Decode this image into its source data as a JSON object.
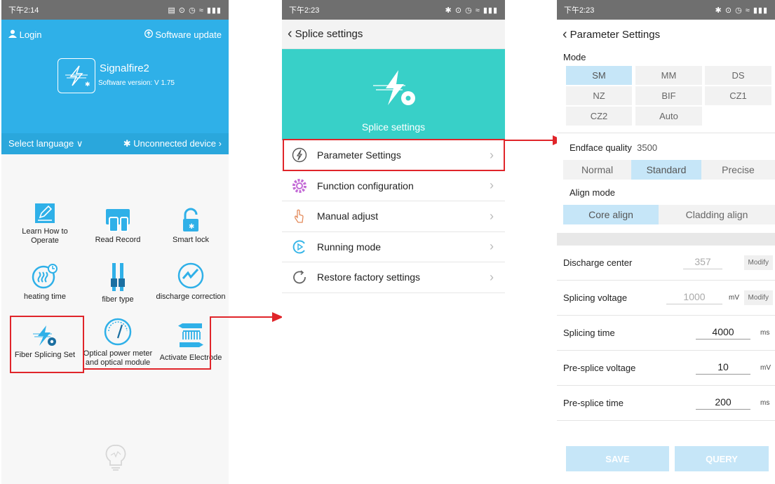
{
  "phone1": {
    "status_time": "下午2:14",
    "login": "Login",
    "software_update": "Software update",
    "app_name": "Signalfire2",
    "software_version": "Software version: V 1.75",
    "select_language": "Select language",
    "unconnected_device": "Unconnected device",
    "grid": [
      {
        "label": "Learn How to Operate",
        "icon": "learn-icon"
      },
      {
        "label": "Read Record",
        "icon": "read-record-icon"
      },
      {
        "label": "Smart lock",
        "icon": "smart-lock-icon"
      },
      {
        "label": "heating time",
        "icon": "heating-icon"
      },
      {
        "label": "fiber type",
        "icon": "fiber-type-icon"
      },
      {
        "label": "discharge correction",
        "icon": "discharge-icon"
      },
      {
        "label": "Fiber Splicing Set",
        "icon": "fiber-splicing-icon"
      },
      {
        "label": "Optical power meter and optical module",
        "icon": "power-meter-icon"
      },
      {
        "label": "Activate Electrode",
        "icon": "electrode-icon"
      }
    ]
  },
  "phone2": {
    "status_time": "下午2:23",
    "nav_title": "Splice settings",
    "banner_label": "Splice settings",
    "menu": [
      {
        "label": "Parameter Settings",
        "icon": "lightning-icon"
      },
      {
        "label": "Function configuration",
        "icon": "gear-icon"
      },
      {
        "label": "Manual adjust",
        "icon": "hand-icon"
      },
      {
        "label": "Running mode",
        "icon": "running-mode-icon"
      },
      {
        "label": "Restore factory settings",
        "icon": "restore-icon"
      }
    ]
  },
  "phone3": {
    "status_time": "下午2:23",
    "nav_title": "Parameter Settings",
    "mode_label": "Mode",
    "modes": [
      "SM",
      "MM",
      "DS",
      "NZ",
      "BIF",
      "CZ1",
      "CZ2",
      "Auto"
    ],
    "selected_mode": "SM",
    "endface_label": "Endface quality",
    "endface_value": "3500",
    "endface_options": [
      "Normal",
      "Standard",
      "Precise"
    ],
    "selected_endface": "Standard",
    "align_label": "Align mode",
    "align_options": [
      "Core align",
      "Cladding align"
    ],
    "selected_align": "Core align",
    "params": [
      {
        "label": "Discharge center",
        "value": "357",
        "unit": "",
        "button": "Modify"
      },
      {
        "label": "Splicing voltage",
        "value": "1000",
        "unit": "mV",
        "button": "Modify"
      },
      {
        "label": "Splicing time",
        "value": "4000",
        "unit": "ms",
        "button": ""
      },
      {
        "label": "Pre-splice voltage",
        "value": "10",
        "unit": "mV",
        "button": ""
      },
      {
        "label": "Pre-splice time",
        "value": "200",
        "unit": "ms",
        "button": ""
      }
    ],
    "save": "SAVE",
    "query": "QUERY"
  },
  "colors": {
    "header_blue": "#2fb0e8",
    "teal_banner": "#38d0c8",
    "highlight_red": "#e0252a",
    "selected_segment": "#c6e6f8"
  }
}
